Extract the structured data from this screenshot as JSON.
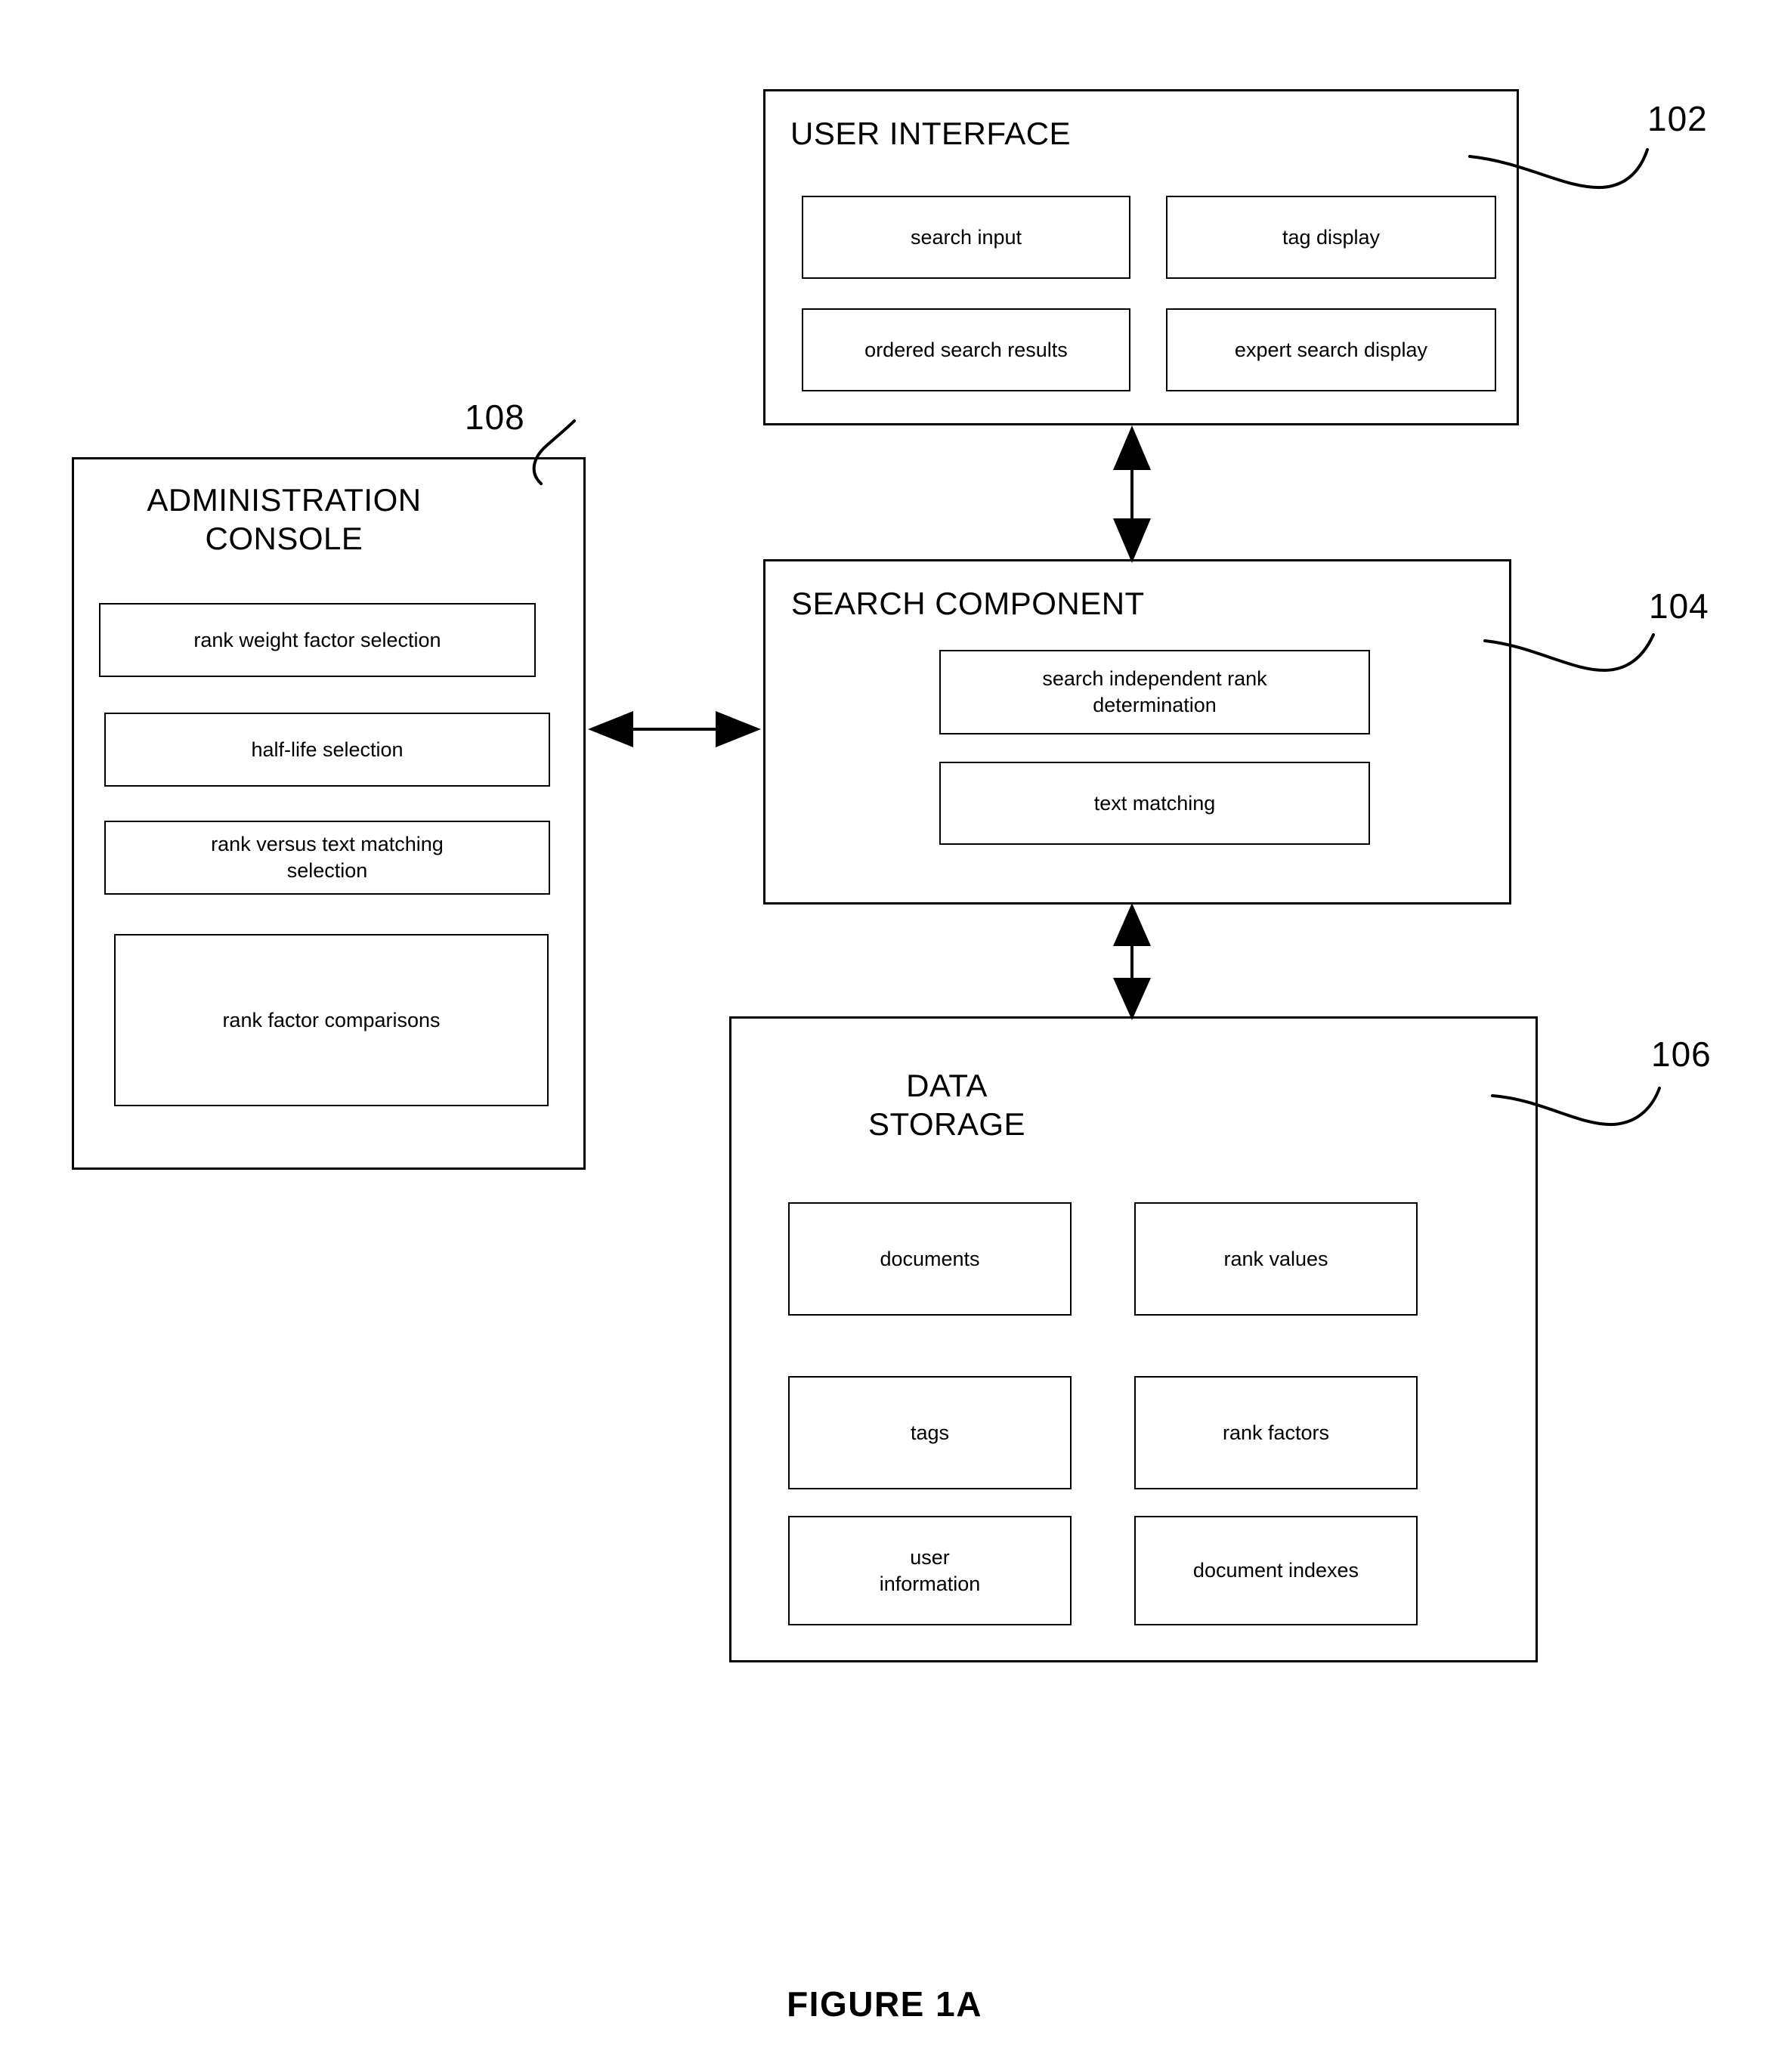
{
  "figure": {
    "caption": "FIGURE 1A"
  },
  "modules": {
    "user_interface": {
      "title": "USER INTERFACE",
      "ref": "102",
      "items": [
        {
          "label": "search input"
        },
        {
          "label": "tag display"
        },
        {
          "label": "ordered search results"
        },
        {
          "label": "expert search display"
        }
      ]
    },
    "search_component": {
      "title": "SEARCH COMPONENT",
      "ref": "104",
      "items": [
        {
          "label": "search independent rank\ndetermination"
        },
        {
          "label": "text matching"
        }
      ]
    },
    "data_storage": {
      "title": "DATA\nSTORAGE",
      "ref": "106",
      "items": [
        {
          "label": "documents"
        },
        {
          "label": "rank values"
        },
        {
          "label": "tags"
        },
        {
          "label": "rank factors"
        },
        {
          "label": "user\ninformation"
        },
        {
          "label": "document indexes"
        }
      ]
    },
    "administration_console": {
      "title": "ADMINISTRATION\nCONSOLE",
      "ref": "108",
      "items": [
        {
          "label": "rank weight factor selection"
        },
        {
          "label": "half-life selection"
        },
        {
          "label": "rank versus text matching\nselection"
        },
        {
          "label": "rank factor comparisons"
        }
      ]
    }
  },
  "connectors": [
    {
      "name": "ui-to-search",
      "direction": "bidirectional",
      "orientation": "vertical"
    },
    {
      "name": "search-to-storage",
      "direction": "bidirectional",
      "orientation": "vertical"
    },
    {
      "name": "admin-to-search",
      "direction": "bidirectional",
      "orientation": "horizontal"
    }
  ],
  "colors": {
    "stroke": "#000000",
    "background": "#ffffff"
  }
}
